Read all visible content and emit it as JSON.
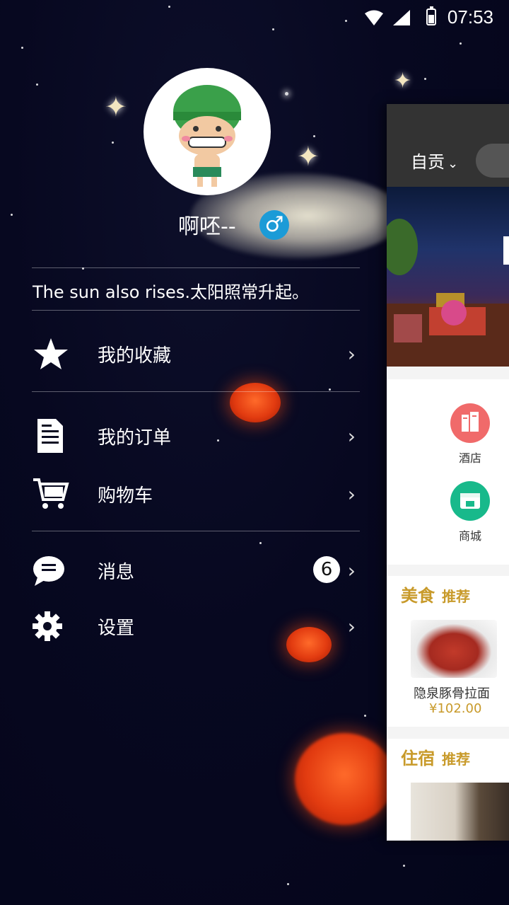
{
  "status_bar": {
    "time": "07:53"
  },
  "profile": {
    "nickname": "啊呸--",
    "gender_symbol": "♂",
    "signature": "The sun also rises.太阳照常升起。"
  },
  "menu": {
    "favorites": "我的收藏",
    "orders": "我的订单",
    "cart": "购物车",
    "messages": "消息",
    "messages_badge": "6",
    "settings": "设置",
    "chevron": "›"
  },
  "main_panel": {
    "city": "自贡",
    "city_arrow": "⌄",
    "categories": [
      {
        "label": "酒店",
        "color": "#f06a6a",
        "icon": "hotel-icon"
      },
      {
        "label": "商城",
        "color": "#18b98b",
        "icon": "store-icon"
      }
    ],
    "food_section": {
      "title": "美食",
      "subtitle": "推荐",
      "item_name": "隐泉豚骨拉面",
      "item_price": "¥102.00"
    },
    "stay_section": {
      "title": "住宿",
      "subtitle": "推荐"
    }
  },
  "colors": {
    "gold": "#c89a2a",
    "gender_blue": "#1b9bd7",
    "lantern_red": "#e23b10"
  }
}
